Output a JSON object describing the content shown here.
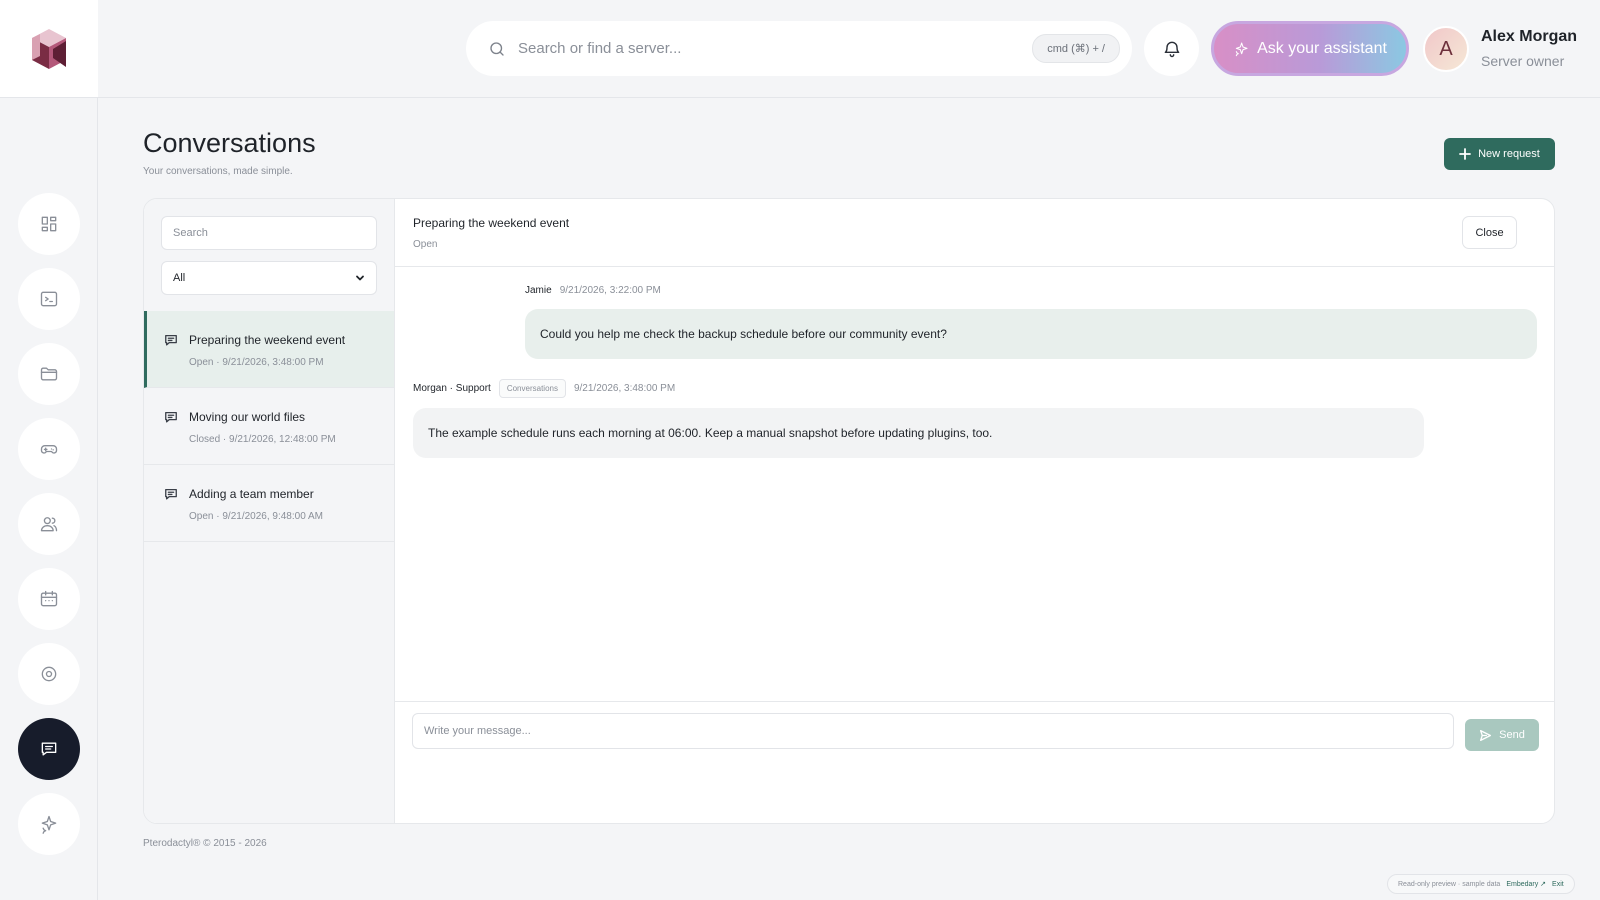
{
  "brand": {
    "colors": {
      "accent": "#2f6b5e",
      "nav_active": "#171c2b",
      "logo_dark": "#7a2c44",
      "logo_light": "#d9a1b2"
    }
  },
  "sidebar": {
    "items": [
      {
        "name": "dashboard",
        "icon": "grid-icon"
      },
      {
        "name": "console",
        "icon": "terminal-icon"
      },
      {
        "name": "files",
        "icon": "folder-icon"
      },
      {
        "name": "games",
        "icon": "gamepad-icon"
      },
      {
        "name": "users",
        "icon": "users-icon"
      },
      {
        "name": "schedules",
        "icon": "calendar-icon"
      },
      {
        "name": "settings",
        "icon": "gear-icon"
      },
      {
        "name": "conversations",
        "icon": "chat-icon",
        "active": true
      },
      {
        "name": "assistant",
        "icon": "sparkle-icon"
      }
    ]
  },
  "header": {
    "search_placeholder": "Search or find a server...",
    "search_shortcut": "cmd (⌘) + /",
    "assistant_label": "Ask your assistant",
    "user": {
      "initial": "A",
      "name": "Alex Morgan",
      "role": "Server owner"
    }
  },
  "page": {
    "title": "Conversations",
    "subtitle": "Your conversations, made simple.",
    "new_request_label": "New request"
  },
  "list": {
    "search_placeholder": "Search",
    "filter_value": "All",
    "items": [
      {
        "title": "Preparing the weekend event",
        "meta": "Open · 9/21/2026, 3:48:00 PM",
        "active": true
      },
      {
        "title": "Moving our world files",
        "meta": "Closed · 9/21/2026, 12:48:00 PM"
      },
      {
        "title": "Adding a team member",
        "meta": "Open · 9/21/2026, 9:48:00 AM"
      }
    ]
  },
  "thread": {
    "title": "Preparing the weekend event",
    "status": "Open",
    "close_label": "Close",
    "messages": [
      {
        "author": "Jamie",
        "time": "9/21/2026, 3:22:00 PM",
        "text": "Could you help me check the backup schedule before our community event?",
        "direction": "out"
      },
      {
        "author": "Morgan · Support",
        "tag": "Conversations",
        "time": "9/21/2026, 3:48:00 PM",
        "text": "The example schedule runs each morning at 06:00. Keep a manual snapshot before updating plugins, too.",
        "direction": "in"
      }
    ],
    "composer_placeholder": "Write your message...",
    "send_label": "Send"
  },
  "footer": {
    "copyright": "Pterodactyl® © 2015 - 2026",
    "preview_text": "Read-only preview · sample data",
    "preview_brand": "Embedary ↗",
    "preview_exit": "Exit"
  }
}
